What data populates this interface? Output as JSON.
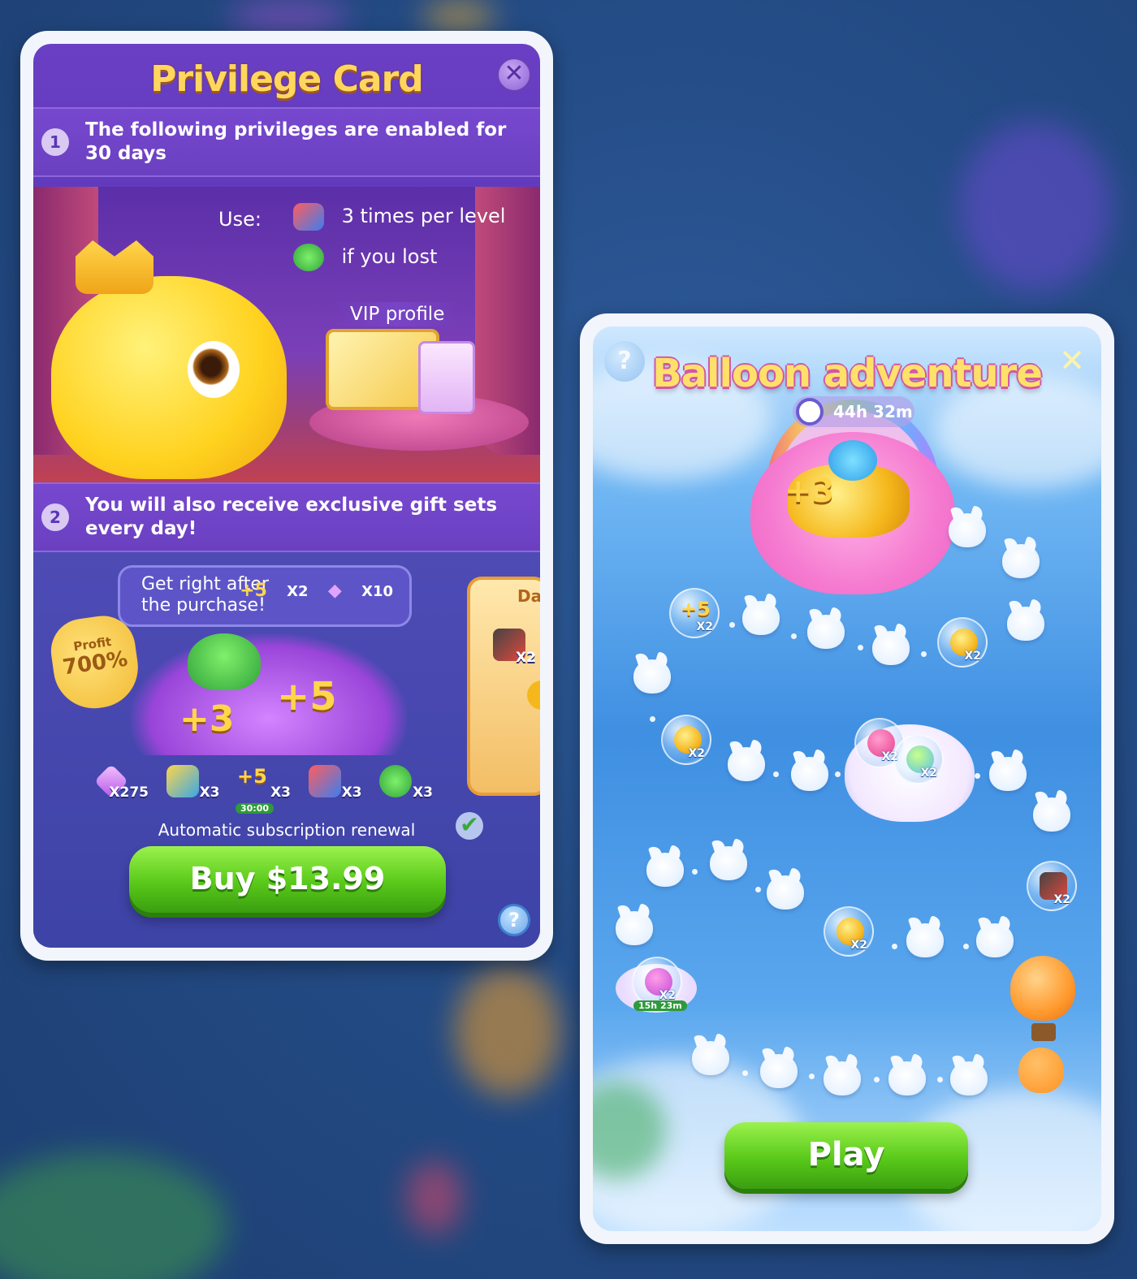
{
  "privilege_card": {
    "title": "Privilege Card",
    "close_icon": "close-icon",
    "step1": {
      "number": "1",
      "text": "The following privileges are enabled for 30 days"
    },
    "use_label": "Use:",
    "privileges": [
      {
        "icon": "rocket-icon",
        "text": "3 times per level"
      },
      {
        "icon": "frog-icon",
        "text": "if you lost"
      }
    ],
    "vip_label": "VIP profile",
    "step2": {
      "number": "2",
      "text": "You will also receive exclusive gift sets every day!"
    },
    "get_after_purchase": {
      "text": "Get right after the purchase!",
      "items": [
        {
          "label": "+5",
          "count": "X2"
        },
        {
          "label": "",
          "count": "X10"
        }
      ]
    },
    "profit_badge": {
      "label": "Profit",
      "value": "700%"
    },
    "bundle_plus": [
      "+3",
      "+5"
    ],
    "bundle_items": [
      {
        "icon": "gem-icon",
        "count": "X275"
      },
      {
        "icon": "picture-booster-icon",
        "count": "X3"
      },
      {
        "icon": "plus5-icon",
        "count": "X3",
        "timer": "30:00",
        "label": "+5"
      },
      {
        "icon": "rocket-icon",
        "count": "X3"
      },
      {
        "icon": "frog-icon",
        "count": "X3"
      }
    ],
    "day_card": {
      "label": "Da",
      "count": "X2"
    },
    "renewal_text": "Automatic subscription renewal",
    "renewal_checked": true,
    "buy_label": "Buy $13.99",
    "help_label": "?"
  },
  "balloon_adventure": {
    "title": "Balloon adventure",
    "help_label": "?",
    "close_label": "✕",
    "timer": "44h 32m",
    "grand_prize_plus": "+3",
    "rewards": [
      {
        "type": "plus5",
        "label": "+5",
        "count": "X2"
      },
      {
        "type": "paw-coin",
        "count": "X2"
      },
      {
        "type": "paw-coin",
        "count": "X2"
      },
      {
        "type": "hammer",
        "count": "X2"
      },
      {
        "type": "potion",
        "count": "X2"
      },
      {
        "type": "board-booster",
        "count": "X2"
      },
      {
        "type": "paw-coin",
        "count": "X2"
      },
      {
        "type": "characters",
        "count": "X2",
        "timer": "15h 23m"
      }
    ],
    "play_label": "Play"
  },
  "colors": {
    "green_button": "#59c91a",
    "title_gold": "#ffd75e",
    "panel_purple": "#5a36b6",
    "sky_blue": "#3f8fe2"
  }
}
